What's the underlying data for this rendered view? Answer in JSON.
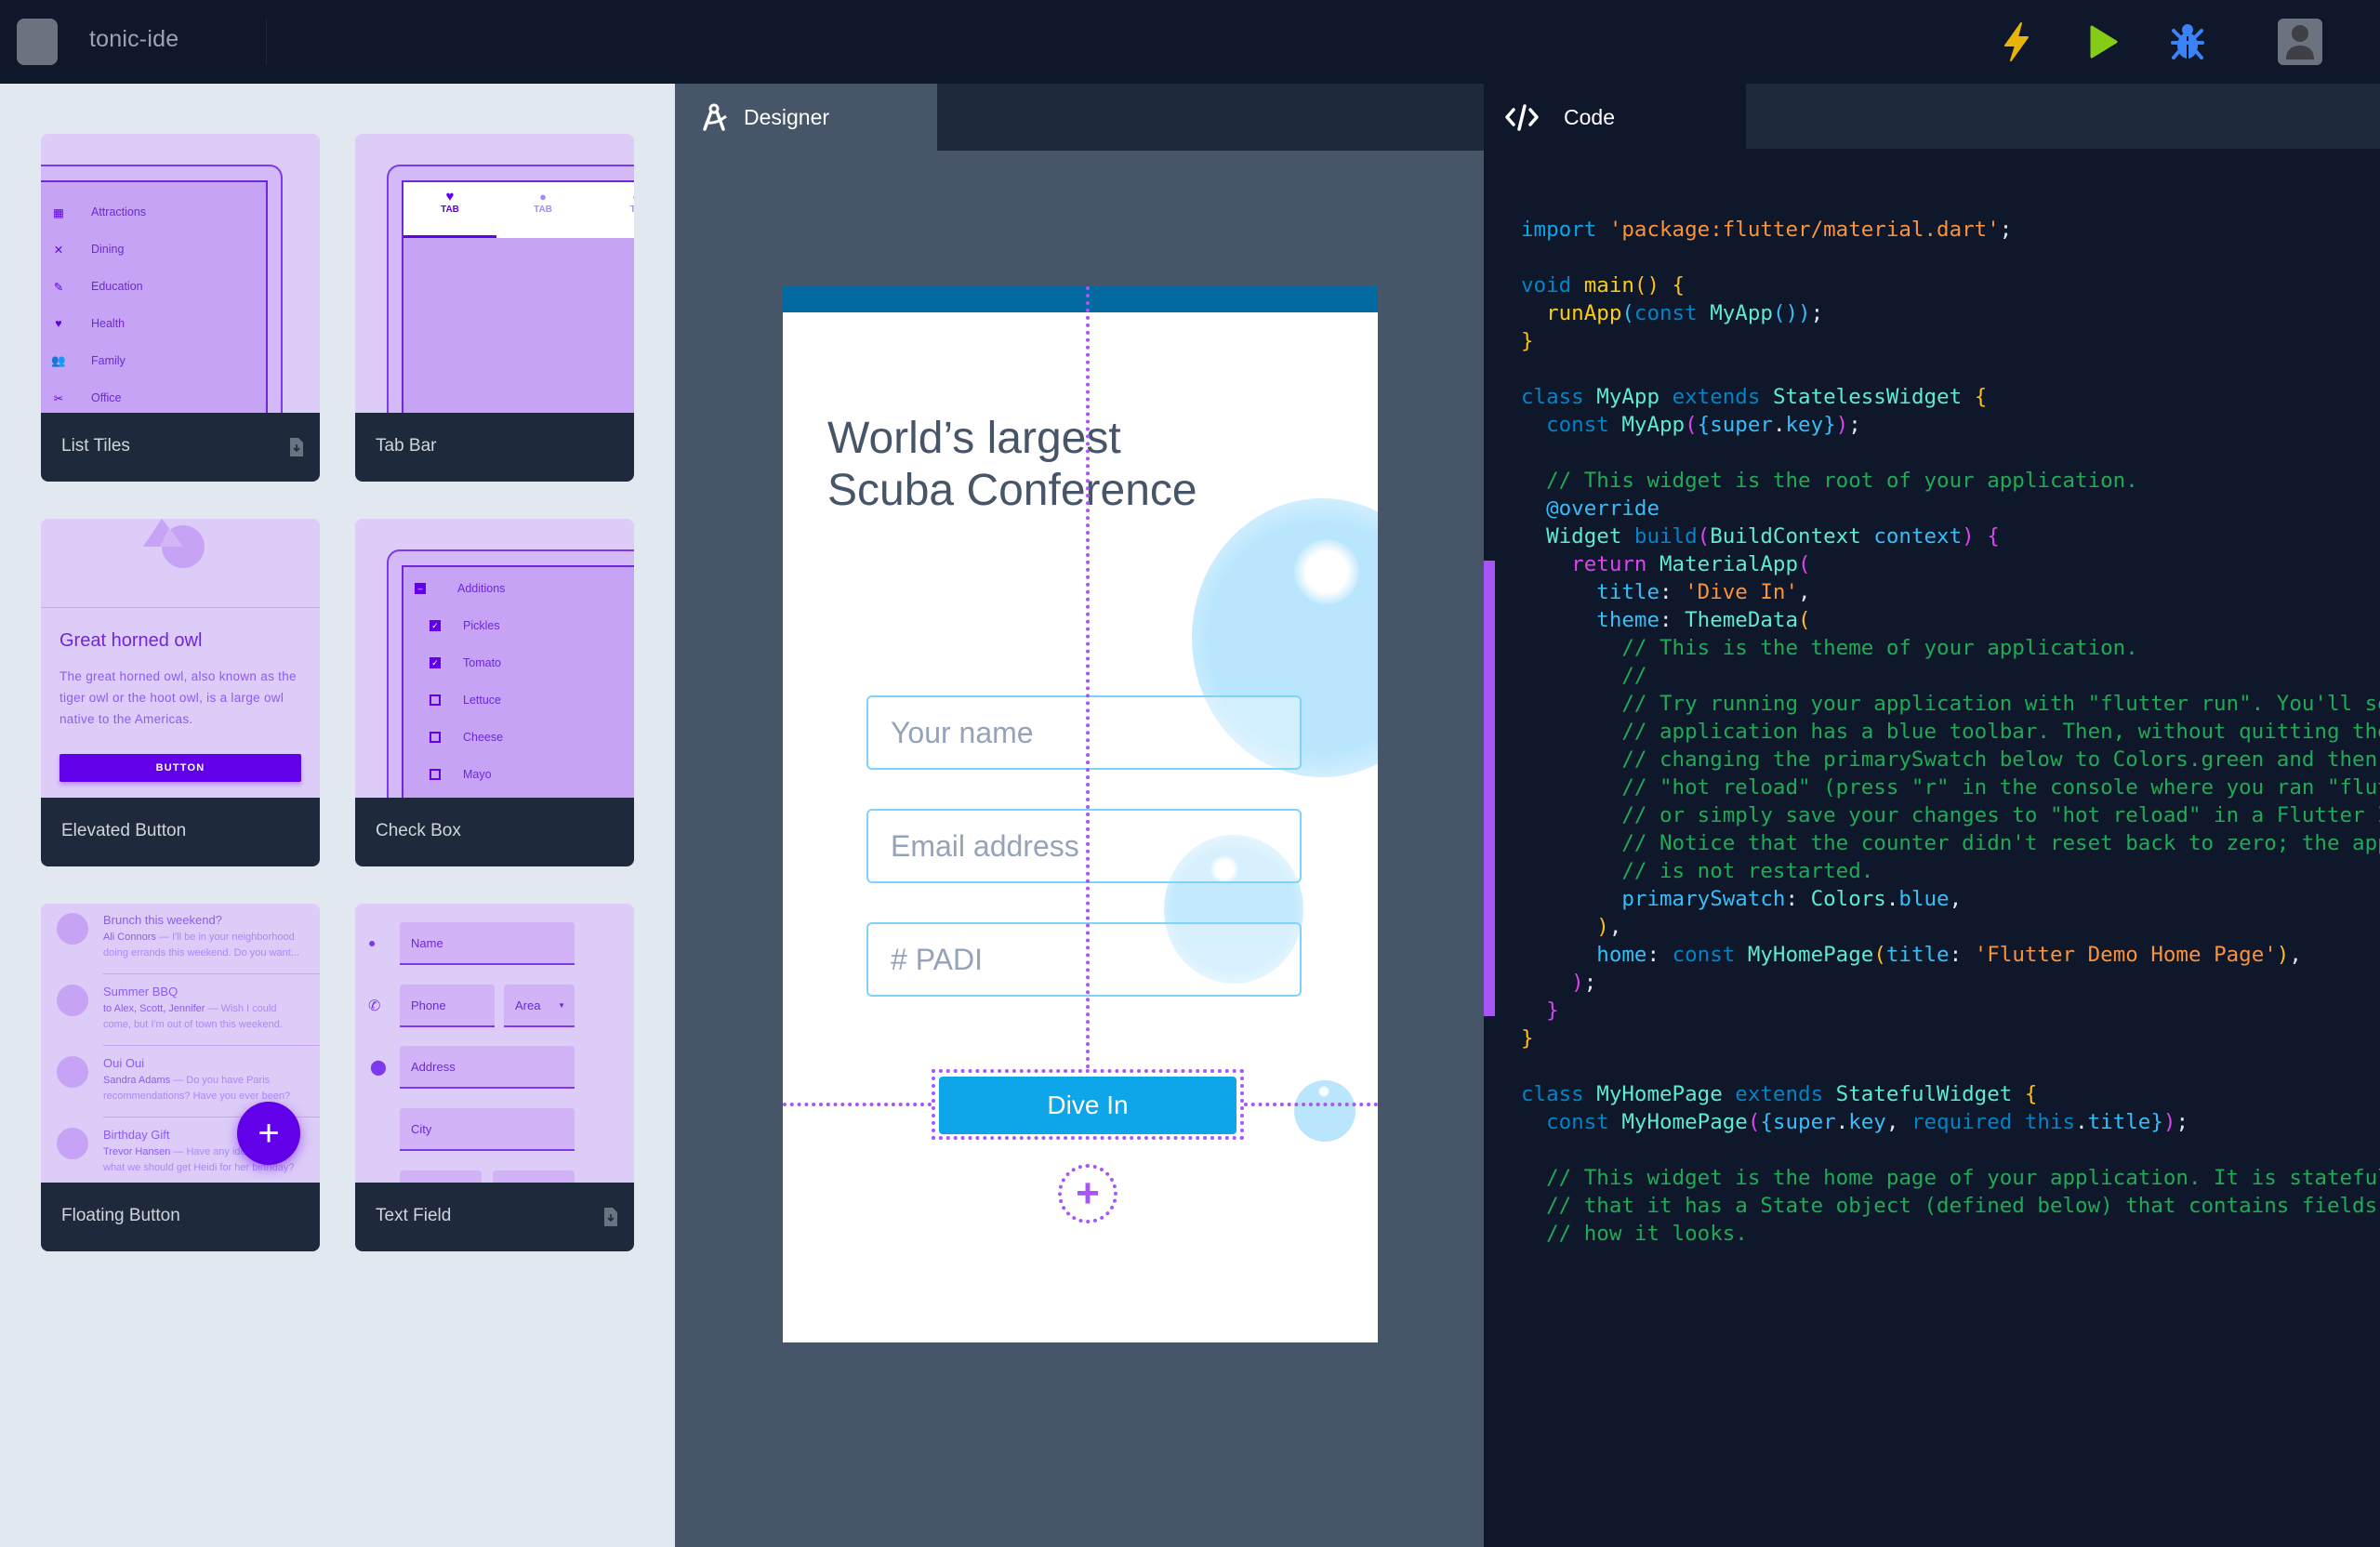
{
  "app": {
    "title": "tonic-ide"
  },
  "toolbar": {
    "actions": [
      {
        "name": "hot-reload",
        "icon": "lightning-icon",
        "color": "#eab308"
      },
      {
        "name": "run",
        "icon": "play-icon",
        "color": "#84cc16"
      },
      {
        "name": "debug",
        "icon": "bug-icon",
        "color": "#3b82f6"
      }
    ],
    "avatar_icon": "user-avatar-icon"
  },
  "widgets": {
    "list_tiles": {
      "label": "List Tiles",
      "items": [
        "Attractions",
        "Dining",
        "Education",
        "Health",
        "Family",
        "Office"
      ]
    },
    "tab_bar": {
      "label": "Tab Bar",
      "tabs": [
        "TAB",
        "TAB",
        "TA"
      ]
    },
    "elevated_button": {
      "label": "Elevated Button",
      "title": "Great horned owl",
      "body": "The great horned owl, also known as the tiger owl or the hoot owl, is a large owl native to the Americas.",
      "button": "BUTTON"
    },
    "check_box": {
      "label": "Check Box",
      "parent": "Additions",
      "items": [
        {
          "label": "Pickles",
          "checked": true
        },
        {
          "label": "Tomato",
          "checked": true
        },
        {
          "label": "Lettuce",
          "checked": false
        },
        {
          "label": "Cheese",
          "checked": false
        },
        {
          "label": "Mayo",
          "checked": false
        }
      ]
    },
    "floating_button": {
      "label": "Floating Button",
      "fab_symbol": "+",
      "messages": [
        {
          "title": "Brunch this weekend?",
          "from": "Ali Connors",
          "text": " — I'll be in your neighborhood",
          "text2": "doing errands this weekend. Do you want..."
        },
        {
          "title": "Summer BBQ",
          "from": "to Alex, Scott, Jennifer",
          "text": " — Wish I could",
          "text2": "come, but I'm out of town this weekend."
        },
        {
          "title": "Oui Oui",
          "from": "Sandra Adams",
          "text": " — Do you have Paris",
          "text2": "recommendations? Have you ever been?"
        },
        {
          "title": "Birthday Gift",
          "from": "Trevor Hansen",
          "text": " — Have any ideas about",
          "text2": "what we should get Heidi for her birthday?"
        }
      ]
    },
    "text_field": {
      "label": "Text Field",
      "fields": {
        "name": "Name",
        "phone": "Phone",
        "area": "Area",
        "address": "Address",
        "city": "City"
      }
    }
  },
  "designer": {
    "tab_label": "Designer",
    "phone": {
      "headline_line1": "World’s largest",
      "headline_line2": "Scuba Conference",
      "inputs": [
        {
          "placeholder": "Your name"
        },
        {
          "placeholder": "Email address"
        },
        {
          "placeholder": "# PADI"
        }
      ],
      "button": "Dive In",
      "add_symbol": "+"
    }
  },
  "code": {
    "tab_label": "Code",
    "lines": [
      [
        [
          "k",
          "import "
        ],
        [
          "s",
          "'package:flutter/material.dart'"
        ],
        [
          "w",
          ";"
        ]
      ],
      [],
      [
        [
          "kw2",
          "void "
        ],
        [
          "f",
          "main"
        ],
        [
          "y",
          "() {"
        ]
      ],
      [
        [
          "w",
          "  "
        ],
        [
          "f",
          "runApp"
        ],
        [
          "p",
          "("
        ],
        [
          "kw2",
          "const "
        ],
        [
          "t",
          "MyApp"
        ],
        [
          "p",
          "()"
        ],
        [
          "p",
          ")"
        ],
        [
          "w",
          ";"
        ]
      ],
      [
        [
          "y",
          "}"
        ]
      ],
      [],
      [
        [
          "kw2",
          "class "
        ],
        [
          "t",
          "MyApp "
        ],
        [
          "kw2",
          "extends "
        ],
        [
          "t",
          "StatelessWidget "
        ],
        [
          "y",
          "{"
        ]
      ],
      [
        [
          "w",
          "  "
        ],
        [
          "kw2",
          "const "
        ],
        [
          "t",
          "MyApp"
        ],
        [
          "m",
          "("
        ],
        [
          "p",
          "{super"
        ],
        [
          "w",
          "."
        ],
        [
          "p",
          "key}"
        ],
        [
          "m",
          ")"
        ],
        [
          "w",
          ";"
        ]
      ],
      [],
      [
        [
          "c",
          "  // This widget is the root of your application."
        ]
      ],
      [
        [
          "p",
          "  @override"
        ]
      ],
      [
        [
          "t",
          "  Widget "
        ],
        [
          "kw2",
          "build"
        ],
        [
          "m",
          "("
        ],
        [
          "t",
          "BuildContext "
        ],
        [
          "p",
          "context"
        ],
        [
          "m",
          ") {"
        ]
      ],
      [
        [
          "m",
          "    return "
        ],
        [
          "t",
          "MaterialApp"
        ],
        [
          "m",
          "("
        ]
      ],
      [
        [
          "p",
          "      title"
        ],
        [
          "w",
          ": "
        ],
        [
          "s",
          "'Dive In'"
        ],
        [
          "w",
          ","
        ]
      ],
      [
        [
          "p",
          "      theme"
        ],
        [
          "w",
          ": "
        ],
        [
          "t",
          "ThemeData"
        ],
        [
          "y",
          "("
        ]
      ],
      [
        [
          "c",
          "        // This is the theme of your application."
        ]
      ],
      [
        [
          "c",
          "        //"
        ]
      ],
      [
        [
          "c",
          "        // Try running your application with \"flutter run\". You'll see the"
        ]
      ],
      [
        [
          "c",
          "        // application has a blue toolbar. Then, without quitting the app, try"
        ]
      ],
      [
        [
          "c",
          "        // changing the primarySwatch below to Colors.green and then invoke"
        ]
      ],
      [
        [
          "c",
          "        // \"hot reload\" (press \"r\" in the console where you ran \"flutter run\","
        ]
      ],
      [
        [
          "c",
          "        // or simply save your changes to \"hot reload\" in a Flutter IDE)."
        ]
      ],
      [
        [
          "c",
          "        // Notice that the counter didn't reset back to zero; the application"
        ]
      ],
      [
        [
          "c",
          "        // is not restarted."
        ]
      ],
      [
        [
          "p",
          "        primarySwatch"
        ],
        [
          "w",
          ": "
        ],
        [
          "t",
          "Colors"
        ],
        [
          "w",
          "."
        ],
        [
          "p",
          "blue"
        ],
        [
          "w",
          ","
        ]
      ],
      [
        [
          "y",
          "      )"
        ],
        [
          "w",
          ","
        ]
      ],
      [
        [
          "p",
          "      home"
        ],
        [
          "w",
          ": "
        ],
        [
          "kw2",
          "const "
        ],
        [
          "t",
          "MyHomePage"
        ],
        [
          "y",
          "("
        ],
        [
          "p",
          "title"
        ],
        [
          "w",
          ": "
        ],
        [
          "s",
          "'Flutter Demo Home Page'"
        ],
        [
          "y",
          ")"
        ],
        [
          "w",
          ","
        ]
      ],
      [
        [
          "m",
          "    )"
        ],
        [
          "w",
          ";"
        ]
      ],
      [
        [
          "m",
          "  }"
        ]
      ],
      [
        [
          "y",
          "}"
        ]
      ],
      [],
      [
        [
          "kw2",
          "class "
        ],
        [
          "t",
          "MyHomePage "
        ],
        [
          "kw2",
          "extends "
        ],
        [
          "t",
          "StatefulWidget "
        ],
        [
          "y",
          "{"
        ]
      ],
      [
        [
          "w",
          "  "
        ],
        [
          "kw2",
          "const "
        ],
        [
          "t",
          "MyHomePage"
        ],
        [
          "m",
          "("
        ],
        [
          "p",
          "{super"
        ],
        [
          "w",
          "."
        ],
        [
          "p",
          "key"
        ],
        [
          "w",
          ", "
        ],
        [
          "kw2",
          "required "
        ],
        [
          "kw2",
          "this"
        ],
        [
          "w",
          "."
        ],
        [
          "p",
          "title}"
        ],
        [
          "m",
          ")"
        ],
        [
          "w",
          ";"
        ]
      ],
      [],
      [
        [
          "c",
          "  // This widget is the home page of your application. It is stateful, meaning"
        ]
      ],
      [
        [
          "c",
          "  // that it has a State object (defined below) that contains fields that affect"
        ]
      ],
      [
        [
          "c",
          "  // how it looks."
        ]
      ]
    ]
  },
  "colors": {
    "accent": "#a855f7",
    "primary_purple": "#6200ea",
    "sky_button": "#0ea5e9",
    "status_bar": "#0369a1"
  }
}
